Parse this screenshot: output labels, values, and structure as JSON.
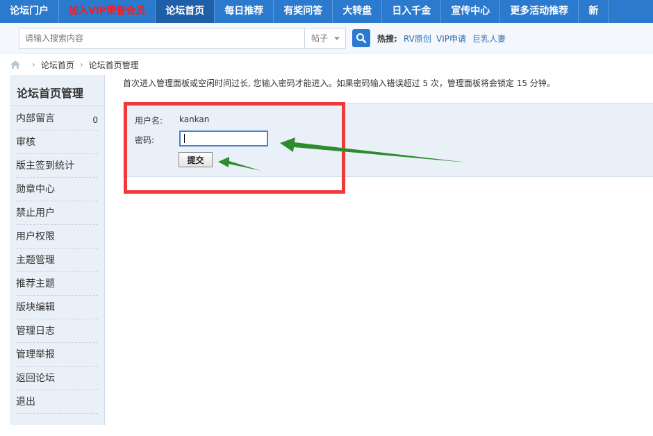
{
  "nav": {
    "items": [
      {
        "label": "论坛门户"
      },
      {
        "label": "加入VIP荣誉会员"
      },
      {
        "label": "论坛首页"
      },
      {
        "label": "每日推荐"
      },
      {
        "label": "有奖问答"
      },
      {
        "label": "大转盘"
      },
      {
        "label": "日入千金"
      },
      {
        "label": "宣传中心"
      },
      {
        "label": "更多活动推荐"
      },
      {
        "label": "新"
      }
    ],
    "active_index": 2,
    "vip_color": "#ff1a1a",
    "bar_color": "#2b7acd"
  },
  "search": {
    "placeholder": "请输入搜索内容",
    "type_selected": "帖子",
    "button_icon": "search-icon",
    "hot_label": "热搜:",
    "hot_links": [
      "RV原创",
      "VIP申请",
      "巨乳人妻"
    ]
  },
  "breadcrumb": {
    "home_icon": "home-icon",
    "items": [
      "论坛首页",
      "论坛首页管理"
    ]
  },
  "sidebar": {
    "title": "论坛首页管理",
    "items": [
      {
        "label": "内部留言",
        "count": "0"
      },
      {
        "label": "审核"
      },
      {
        "label": "版主签到统计"
      },
      {
        "label": "勋章中心"
      },
      {
        "label": "禁止用户"
      },
      {
        "label": "用户权限"
      },
      {
        "label": "主题管理"
      },
      {
        "label": "推荐主题"
      },
      {
        "label": "版块编辑"
      },
      {
        "label": "管理日志"
      },
      {
        "label": "管理举报"
      },
      {
        "label": "返回论坛"
      },
      {
        "label": "退出"
      }
    ]
  },
  "main": {
    "notice": "首次进入管理面板或空闲时间过长, 您输入密码才能进入。如果密码输入错误超过 5 次，管理面板将会锁定 15 分钟。",
    "form": {
      "username_label": "用户名:",
      "username_value": "kankan",
      "password_label": "密码:",
      "password_value": "",
      "submit_label": "提交"
    }
  },
  "annotation": {
    "box_color": "#f03a3a",
    "arrow_color": "#2e8b2e"
  }
}
